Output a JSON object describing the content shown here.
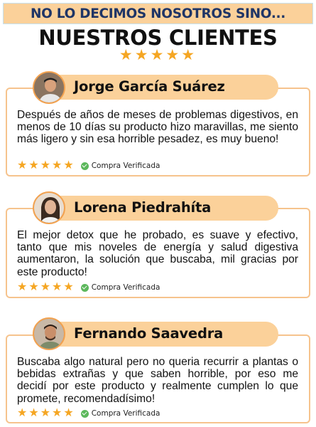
{
  "banner": {
    "text": "NO LO DECIMOS NOSOTROS SINO..."
  },
  "headline": "NUESTROS CLIENTES",
  "header_rating": {
    "stars": "★★★★★",
    "value": 5,
    "max": 5
  },
  "colors": {
    "accent": "#fbd19a",
    "border": "#f6c38d",
    "star": "#f5a623",
    "verified": "#5cb85c",
    "banner_text": "#1f3566"
  },
  "testimonials": [
    {
      "name": "Jorge García Suárez",
      "avatar_icon": "person-avatar-icon",
      "text": "Después de años de meses de problemas digestivos, en menos de 10 días su producto hizo maravillas, me siento más ligero y sin esa horrible pesadez, es muy bueno!",
      "stars": "★★★★★",
      "rating": 5,
      "verified": "Compra Verificada"
    },
    {
      "name": "Lorena Piedrahíta",
      "avatar_icon": "person-avatar-icon",
      "text": "El mejor detox que he probado, es suave y efectivo, tanto que mis noveles de energía y salud digestiva aumentaron, la solución que buscaba, mil gracias por este producto!",
      "stars": "★★★★★",
      "rating": 5,
      "verified": "Compra Verificada"
    },
    {
      "name": "Fernando Saavedra",
      "avatar_icon": "person-avatar-icon",
      "text": "Buscaba algo natural pero no queria recurrir a plantas o bebidas extrañas y que saben horrible, por eso me decidí por este producto y realmente cumplen lo que promete, recomendadísimo!",
      "stars": "★★★★★",
      "rating": 5,
      "verified": "Compra Verificada"
    }
  ]
}
